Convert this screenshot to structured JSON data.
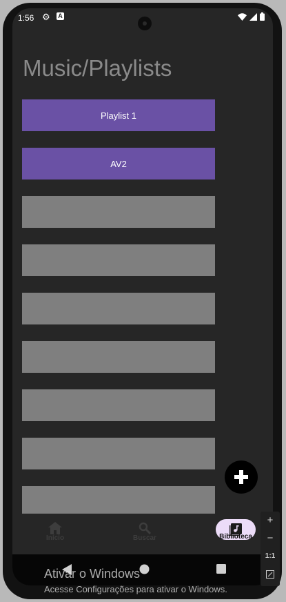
{
  "status_bar": {
    "time": "1:56"
  },
  "title": "Music/Playlists",
  "playlists": [
    {
      "label": "Playlist 1",
      "color": "#6a51a5"
    },
    {
      "label": "AV2",
      "color": "#6a51a5"
    },
    {
      "label": "",
      "color": "#7f7f7f"
    },
    {
      "label": "",
      "color": "#7f7f7f"
    },
    {
      "label": "",
      "color": "#7f7f7f"
    },
    {
      "label": "",
      "color": "#7f7f7f"
    },
    {
      "label": "",
      "color": "#7f7f7f"
    },
    {
      "label": "",
      "color": "#7f7f7f"
    },
    {
      "label": "",
      "color": "#7f7f7f"
    }
  ],
  "fab": {
    "icon": "plus-icon"
  },
  "bottom_nav": {
    "items": [
      {
        "label": "Início",
        "icon": "home-icon",
        "active": false
      },
      {
        "label": "Buscar",
        "icon": "search-icon",
        "active": false
      },
      {
        "label": "Biblioteca",
        "icon": "library-music-icon",
        "active": true
      }
    ]
  },
  "zoom_controls": {
    "plus": "+",
    "minus": "−",
    "ratio": "1:1"
  },
  "watermark": {
    "title": "Ativar o Windows",
    "subtitle": "Acesse Configurações para ativar o Windows."
  },
  "colors": {
    "accent": "#6a51a5",
    "placeholder": "#7f7f7f",
    "background": "#262626",
    "nav_pill": "#ecdcf8"
  }
}
